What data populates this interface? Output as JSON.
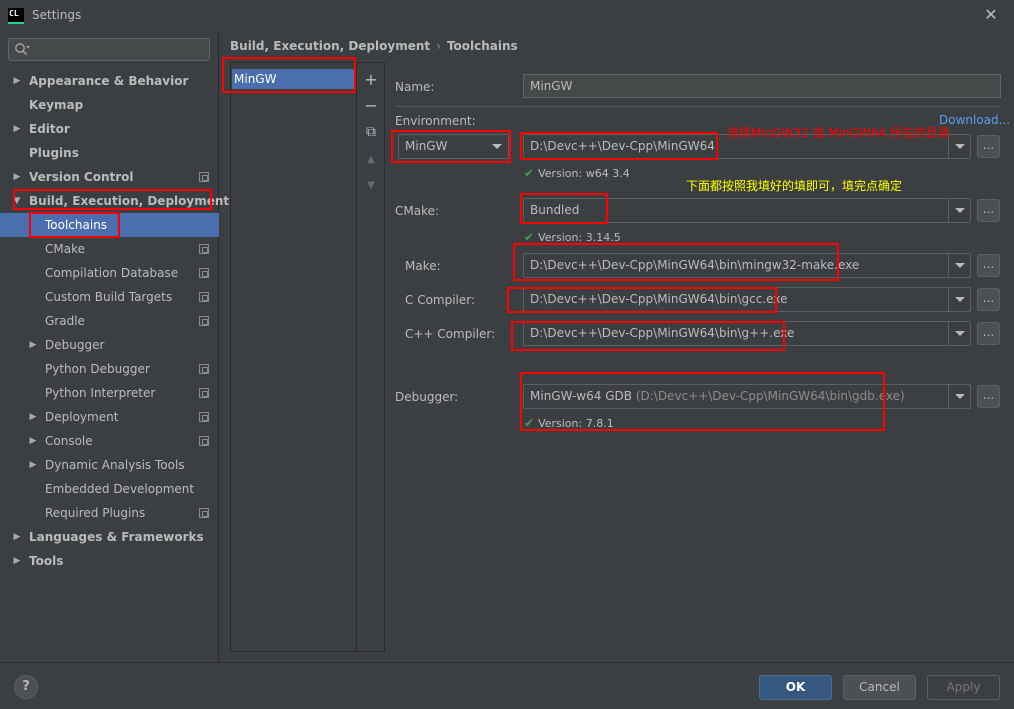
{
  "window": {
    "title": "Settings",
    "app_icon_text": "CL",
    "close_glyph": "✕"
  },
  "search": {
    "placeholder": ""
  },
  "sidebar": {
    "items": [
      {
        "label": "Appearance & Behavior"
      },
      {
        "label": "Keymap"
      },
      {
        "label": "Editor"
      },
      {
        "label": "Plugins"
      },
      {
        "label": "Version Control"
      },
      {
        "label": "Build, Execution, Deployment"
      },
      {
        "label": "Toolchains"
      },
      {
        "label": "CMake"
      },
      {
        "label": "Compilation Database"
      },
      {
        "label": "Custom Build Targets"
      },
      {
        "label": "Gradle"
      },
      {
        "label": "Debugger"
      },
      {
        "label": "Python Debugger"
      },
      {
        "label": "Python Interpreter"
      },
      {
        "label": "Deployment"
      },
      {
        "label": "Console"
      },
      {
        "label": "Dynamic Analysis Tools"
      },
      {
        "label": "Embedded Development"
      },
      {
        "label": "Required Plugins"
      },
      {
        "label": "Languages & Frameworks"
      },
      {
        "label": "Tools"
      }
    ]
  },
  "breadcrumb": {
    "parent": "Build, Execution, Deployment",
    "separator": "›",
    "current": "Toolchains"
  },
  "toolchains": {
    "list": [
      "MinGW"
    ],
    "toolbar": {
      "add": "+",
      "remove": "−",
      "copy": "⧉",
      "up": "▲",
      "down": "▼"
    }
  },
  "form": {
    "name_label": "Name:",
    "name_value": "MinGW",
    "environment_label": "Environment:",
    "download_link": "Download...",
    "environment_type": "MinGW",
    "environment_path": "D:\\Devc++\\Dev-Cpp\\MinGW64",
    "environment_version": "Version: w64 3.4",
    "cmake_label": "CMake:",
    "cmake_value": "Bundled",
    "cmake_version": "Version: 3.14.5",
    "make_label": "Make:",
    "make_value": "D:\\Devc++\\Dev-Cpp\\MinGW64\\bin\\mingw32-make.exe",
    "c_compiler_label": "C Compiler:",
    "c_compiler_value": "D:\\Devc++\\Dev-Cpp\\MinGW64\\bin\\gcc.exe",
    "cpp_compiler_label": "C++ Compiler:",
    "cpp_compiler_value": "D:\\Devc++\\Dev-Cpp\\MinGW64\\bin\\g++.exe",
    "debugger_label": "Debugger:",
    "debugger_name": "MinGW-w64 GDB",
    "debugger_path": "(D:\\Devc++\\Dev-Cpp\\MinGW64\\bin\\gdb.exe)",
    "debugger_version": "Version: 7.8.1",
    "browse": "..."
  },
  "annotations": {
    "red_note": "选择MinGW32 或 MinGW64 所在的目录",
    "yellow_note": "下面都按照我填好的填即可，填完点确定"
  },
  "buttons": {
    "help": "?",
    "ok": "OK",
    "cancel": "Cancel",
    "apply": "Apply"
  },
  "colors": {
    "background": "#3c3f41",
    "selection": "#4b6eaf",
    "link": "#589df6",
    "check": "#499c54",
    "annotation_red": "#ff0000",
    "annotation_yellow": "#ffff00"
  }
}
